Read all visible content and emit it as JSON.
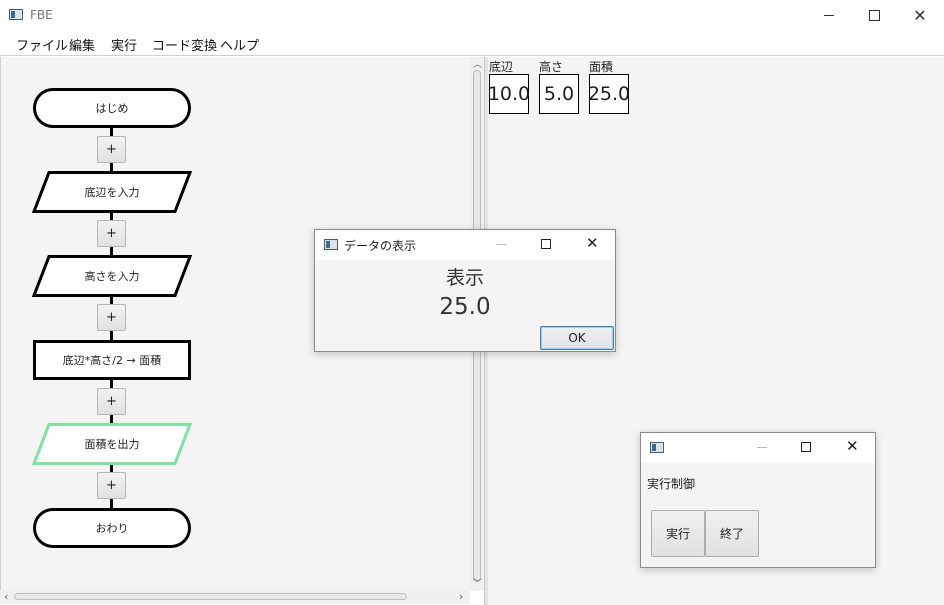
{
  "window": {
    "title": "FBE"
  },
  "menu": [
    "ファイル",
    "編集",
    "実行",
    "コード変換",
    "ヘルプ"
  ],
  "flowchart": {
    "start": "はじめ",
    "input_base": "底辺を入力",
    "input_height": "高さを入力",
    "process": "底辺*高さ/2 → 面積",
    "output": "面積を出力",
    "end": "おわり",
    "add_label": "+"
  },
  "variables": [
    {
      "name": "底辺",
      "value": "10.0"
    },
    {
      "name": "高さ",
      "value": "5.0"
    },
    {
      "name": "面積",
      "value": "25.0"
    }
  ],
  "display_dialog": {
    "title": "データの表示",
    "heading": "表示",
    "value": "25.0",
    "ok_label": "OK"
  },
  "control_dialog": {
    "title": "",
    "label": "実行制御",
    "run_label": "実行",
    "stop_label": "終了"
  },
  "colors": {
    "selected_outline": "#7fe2a0",
    "panel_bg": "#f4f4f4",
    "button_focus": "#3c7fb1"
  }
}
